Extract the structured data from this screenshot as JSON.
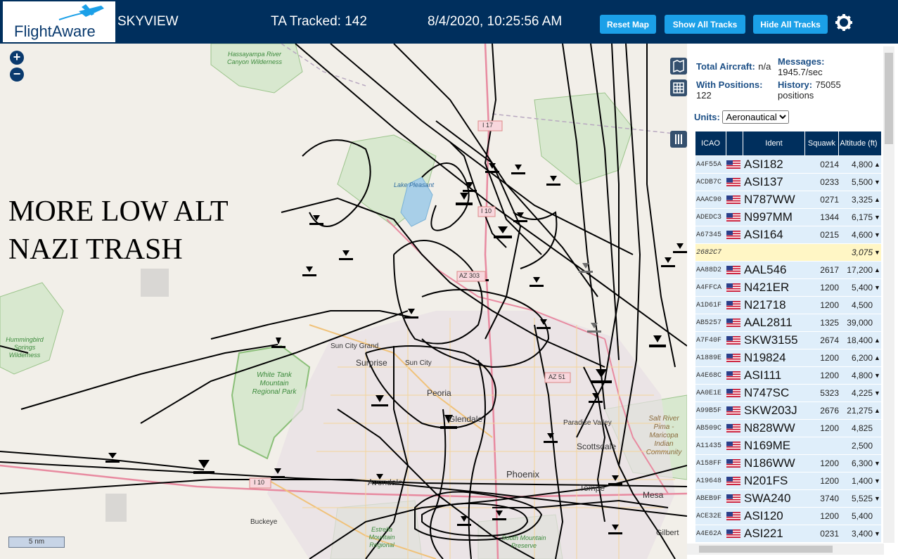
{
  "header": {
    "logo_text": "FlightAware",
    "app_name": "SKYVIEW",
    "ta_tracked": "TA Tracked: 142",
    "datetime": "8/4/2020, 10:25:56 AM",
    "reset_map": "Reset Map",
    "show_all_tracks": "Show All Tracks",
    "hide_all_tracks": "Hide All Tracks"
  },
  "map": {
    "overlay_text": "MORE LOW ALT\nNAZI TRASH",
    "scale_label": "5 nm",
    "zoom_in": "+",
    "zoom_out": "−",
    "labels": {
      "hassayampa": "Hassayampa River Canyon Wilderness",
      "hummingbird": "Hummingbird Springs Wilderness",
      "white_tank": "White Tank Mountain Regional Park",
      "lake_pleasant": "Lake Pleasant",
      "sun_city_grand": "Sun City Grand",
      "surprise": "Surprise",
      "sun_city": "Sun City",
      "peoria": "Peoria",
      "glendale": "Glendale",
      "paradise_valley": "Paradise Valley",
      "scottsdale": "Scottsdale",
      "salt_river": "Salt River Pima - Maricopa Indian Community",
      "phoenix": "Phoenix",
      "tempe": "Tempe",
      "avondale": "Avondale",
      "buckeye": "Buckeye",
      "estrella": "Estrella Mountain Regional",
      "south_mountain": "South Mountain Preserve",
      "mesa": "Mesa",
      "gilbert": "Gilbert",
      "i17": "I 17",
      "i10": "I 10",
      "az51": "AZ 51",
      "az303": "AZ 303"
    }
  },
  "stats": {
    "total_aircraft_label": "Total Aircraft:",
    "total_aircraft_value": "n/a",
    "with_positions_label": "With Positions:",
    "with_positions_value": "122",
    "messages_label": "Messages:",
    "messages_value": "1945.7/sec",
    "history_label": "History:",
    "history_value": "75055 positions"
  },
  "units": {
    "label": "Units:",
    "selected": "Aeronautical"
  },
  "table": {
    "headers": {
      "icao": "ICAO",
      "ident": "Ident",
      "squawk": "Squawk",
      "altitude": "Altitude (ft)"
    },
    "rows": [
      {
        "icao": "A4F55A",
        "ident": "ASI182",
        "squawk": "0214",
        "alt": "4,800",
        "trend": "▲"
      },
      {
        "icao": "ACDB7C",
        "ident": "ASI137",
        "squawk": "0233",
        "alt": "5,500",
        "trend": "▼"
      },
      {
        "icao": "AAAC90",
        "ident": "N787WW",
        "squawk": "0271",
        "alt": "3,325",
        "trend": "▲"
      },
      {
        "icao": "ADEDC3",
        "ident": "N997MM",
        "squawk": "1344",
        "alt": "6,175",
        "trend": "▼"
      },
      {
        "icao": "A67345",
        "ident": "ASI164",
        "squawk": "0215",
        "alt": "4,600",
        "trend": "▼"
      },
      {
        "icao": "2682C7",
        "ident": "",
        "squawk": "",
        "alt": "3,075",
        "trend": "▼",
        "selected": true
      },
      {
        "icao": "AA88D2",
        "ident": "AAL546",
        "squawk": "2617",
        "alt": "17,200",
        "trend": "▲"
      },
      {
        "icao": "A4FFCA",
        "ident": "N421ER",
        "squawk": "1200",
        "alt": "5,400",
        "trend": "▼"
      },
      {
        "icao": "A1D61F",
        "ident": "N21718",
        "squawk": "1200",
        "alt": "4,500",
        "trend": ""
      },
      {
        "icao": "AB5257",
        "ident": "AAL2811",
        "squawk": "1325",
        "alt": "39,000",
        "trend": ""
      },
      {
        "icao": "A7F40F",
        "ident": "SKW3155",
        "squawk": "2674",
        "alt": "18,400",
        "trend": "▲"
      },
      {
        "icao": "A1889E",
        "ident": "N19824",
        "squawk": "1200",
        "alt": "6,200",
        "trend": "▲"
      },
      {
        "icao": "A4E68C",
        "ident": "ASI111",
        "squawk": "1200",
        "alt": "4,800",
        "trend": "▼"
      },
      {
        "icao": "AA0E1E",
        "ident": "N747SC",
        "squawk": "5323",
        "alt": "4,225",
        "trend": "▼"
      },
      {
        "icao": "A99B5F",
        "ident": "SKW203J",
        "squawk": "2676",
        "alt": "21,275",
        "trend": "▲"
      },
      {
        "icao": "AB509C",
        "ident": "N828WW",
        "squawk": "1200",
        "alt": "4,825",
        "trend": ""
      },
      {
        "icao": "A11435",
        "ident": "N169ME",
        "squawk": "",
        "alt": "2,500",
        "trend": ""
      },
      {
        "icao": "A158FF",
        "ident": "N186WW",
        "squawk": "1200",
        "alt": "6,300",
        "trend": "▼"
      },
      {
        "icao": "A19648",
        "ident": "N201FS",
        "squawk": "1200",
        "alt": "1,400",
        "trend": "▼"
      },
      {
        "icao": "ABEB9F",
        "ident": "SWA240",
        "squawk": "3740",
        "alt": "5,525",
        "trend": "▼"
      },
      {
        "icao": "ACE32E",
        "ident": "ASI120",
        "squawk": "1200",
        "alt": "5,400",
        "trend": ""
      },
      {
        "icao": "A4E62A",
        "ident": "ASI221",
        "squawk": "0231",
        "alt": "3,400",
        "trend": "▼"
      }
    ]
  },
  "colors": {
    "header_bg": "#002f5d",
    "button_bg": "#1ba0e8",
    "row_bg": "#dfeefa",
    "selected_row_bg": "#fff6c5",
    "map_bg": "#f2efe9",
    "park_green": "#cfe6c4",
    "water": "#a8cfe8",
    "track": "#000000"
  }
}
